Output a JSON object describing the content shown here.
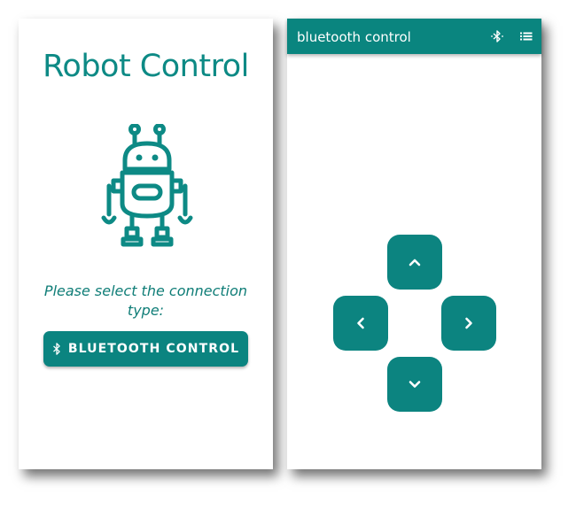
{
  "left_screen": {
    "title": "Robot Control",
    "robot_icon": "robot-icon",
    "prompt": "Please select the connection type:",
    "button": {
      "label": "BLUETOOTH CONTROL",
      "icon": "bluetooth-icon"
    }
  },
  "right_screen": {
    "appbar": {
      "title": "bluetooth control",
      "icons": [
        "bluetooth-icon",
        "list-icon"
      ]
    },
    "dpad": {
      "up": "chevron-up-icon",
      "left": "chevron-left-icon",
      "right": "chevron-right-icon",
      "down": "chevron-down-icon"
    }
  },
  "colors": {
    "primary": "#0a857f",
    "text_teal": "#0d8a85",
    "background": "#ffffff"
  }
}
